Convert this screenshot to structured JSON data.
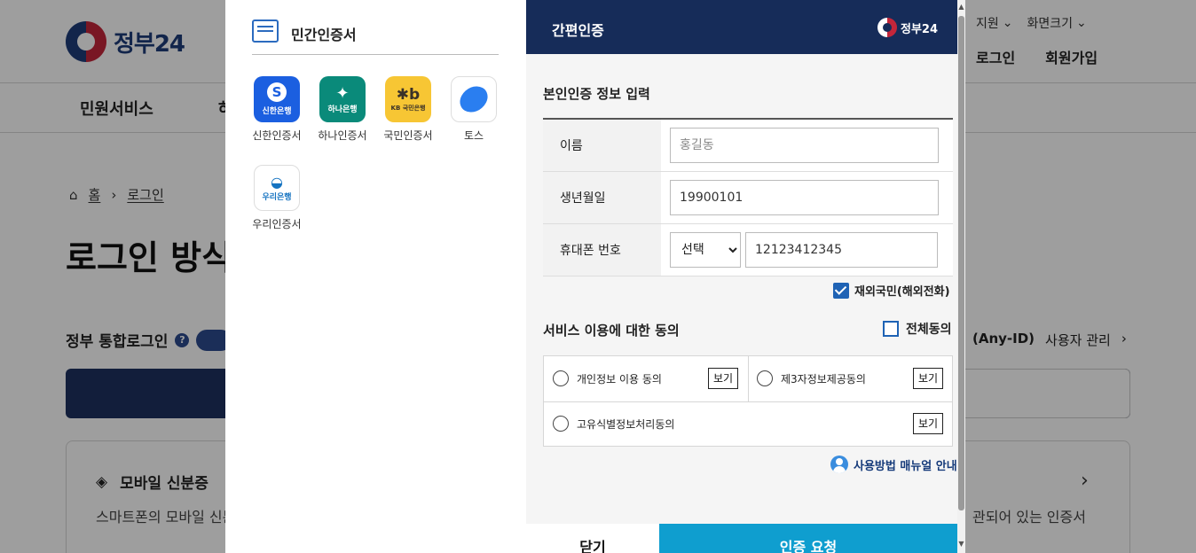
{
  "background": {
    "logo_text": "정부24",
    "util": {
      "support": "지원",
      "screen_size": "화면크기"
    },
    "auth": {
      "login": "로그인",
      "signup": "회원가입"
    },
    "gnb": {
      "item1": "민원서비스",
      "item2_partial": "하"
    },
    "breadcrumb": {
      "home": "홈",
      "current": "로그인"
    },
    "page_title": "로그인 방식",
    "integrated_login": "정부 통합로그인",
    "help": "?",
    "anyid": "(Any-ID)",
    "user_manage": "사용자 관리",
    "card": {
      "title": "모바일 신분증",
      "desc": "스마트폰의 모바일 신분",
      "desc_right": "관되어 있는 인증서"
    }
  },
  "modal": {
    "left": {
      "title": "민간인증서",
      "banks": [
        {
          "tile": "신한은행",
          "label": "신한인증서"
        },
        {
          "tile": "하나은행",
          "label": "하나인증서"
        },
        {
          "tile": "KB 국민은행",
          "label": "국민인증서"
        },
        {
          "tile": "",
          "label": "토스"
        },
        {
          "tile": "우리은행",
          "label": "우리인증서"
        }
      ]
    },
    "right": {
      "header_title": "간편인증",
      "brand": "정부24",
      "section_title": "본인인증 정보 입력",
      "fields": {
        "name_label": "이름",
        "name_placeholder": "홍길동",
        "birth_label": "생년월일",
        "birth_value": "19900101",
        "phone_label": "휴대폰 번호",
        "phone_select": "선택",
        "phone_value": "12123412345"
      },
      "overseas_label": "재외국민(해외전화)",
      "agree_title": "서비스 이용에 대한 동의",
      "agree_all": "전체동의",
      "agreements": [
        {
          "label": "개인정보 이용 동의",
          "button": "보기"
        },
        {
          "label": "제3자정보제공동의",
          "button": "보기"
        },
        {
          "label": "고유식별정보처리동의",
          "button": "보기"
        }
      ],
      "manual": "사용방법 매뉴얼 안내",
      "close": "닫기",
      "request": "인증 요청"
    }
  },
  "colors": {
    "header_navy": "#162c59",
    "request_blue": "#0f9ecf",
    "check_blue": "#1f63b5"
  }
}
